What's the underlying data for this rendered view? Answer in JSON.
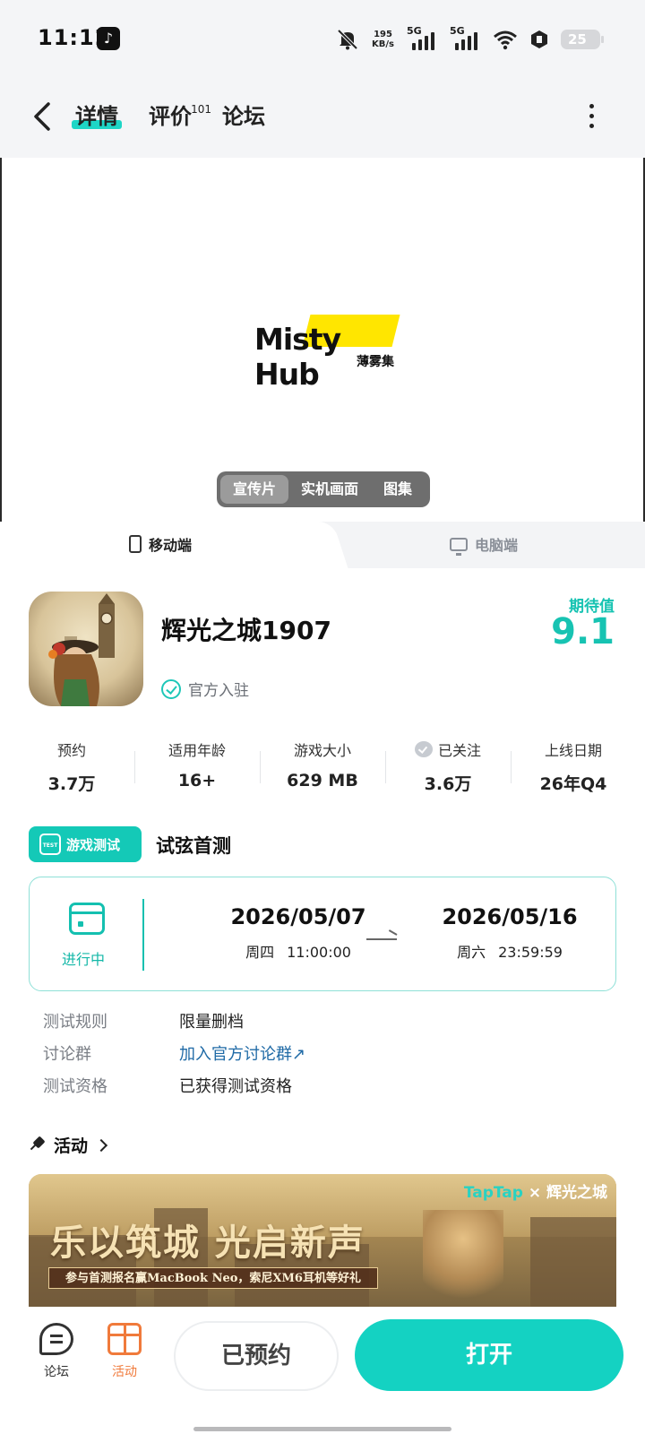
{
  "status_bar": {
    "time": "11:12",
    "net_speed_value": "195",
    "net_speed_unit": "KB/s",
    "sim1_label": "5G",
    "sim2_label": "5G",
    "battery": "25"
  },
  "header": {
    "tabs": [
      {
        "label": "详情",
        "active": true
      },
      {
        "label": "评价",
        "count": "101"
      },
      {
        "label": "论坛"
      }
    ]
  },
  "media": {
    "logo_text": "Misty Hub",
    "logo_cn": "薄雾集",
    "segments": [
      "宣传片",
      "实机画面",
      "图集"
    ],
    "selected_segment": "宣传片"
  },
  "platform_tabs": {
    "mobile": "移动端",
    "pc": "电脑端",
    "selected": "移动端"
  },
  "app": {
    "name": "辉光之城1907",
    "verified_label": "官方入驻",
    "expect_label": "期待值",
    "expect_score": "9.1"
  },
  "stats": [
    {
      "label": "预约",
      "value": "3.7万"
    },
    {
      "label": "适用年龄",
      "value": "16+"
    },
    {
      "label": "游戏大小",
      "value": "629 MB"
    },
    {
      "label": "已关注",
      "value": "3.6万",
      "icon": "check-heart-icon"
    },
    {
      "label": "上线日期",
      "value": "26年Q4"
    }
  ],
  "test": {
    "badge": "游戏测试",
    "badge_icon_text": "TEST",
    "title": "试弦首测",
    "status": "进行中",
    "start": {
      "date": "2026/05/07",
      "weekday": "周四",
      "time": "11:00:00"
    },
    "end": {
      "date": "2026/05/16",
      "weekday": "周六",
      "time": "23:59:59"
    },
    "rows": [
      {
        "key": "测试规则",
        "value": "限量删档"
      },
      {
        "key": "讨论群",
        "value": "加入官方讨论群↗"
      },
      {
        "key": "测试资格",
        "value": "已获得测试资格"
      }
    ]
  },
  "activity": {
    "heading": "活动",
    "banner_brand_left": "TapTap",
    "banner_brand_x": "×",
    "banner_brand_right": "辉光之城",
    "banner_title": "乐以筑城 光启新声",
    "banner_sub": "参与首测报名赢MacBook Neo，索尼XM6耳机等好礼"
  },
  "bottom_bar": {
    "forum_label": "论坛",
    "activity_label": "活动",
    "reserved_button": "已预约",
    "open_button": "打开"
  },
  "colors": {
    "accent": "#14d2c2",
    "link": "#1f6aa6",
    "activity_orange": "#f07a3b"
  }
}
